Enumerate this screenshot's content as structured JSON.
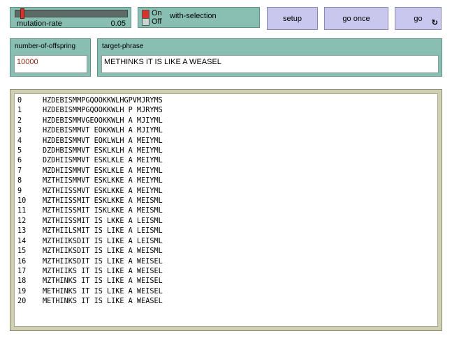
{
  "slider": {
    "label": "mutation-rate",
    "value": "0.05",
    "fraction": 0.05
  },
  "switch": {
    "label": "with-selection",
    "on_text": "On",
    "off_text": "Off",
    "state": "on"
  },
  "buttons": {
    "setup": "setup",
    "go_once": "go once",
    "go": "go",
    "forever_icon": "↻"
  },
  "number_of_offspring": {
    "label": "number-of-offspring",
    "value": "10000"
  },
  "target_phrase": {
    "label": "target-phrase",
    "value": "METHINKS IT IS LIKE A WEASEL"
  },
  "output": {
    "lines": [
      {
        "gen": "0",
        "text": "HZDEBISMMPGQOOKKWLHGPVMJRYMS"
      },
      {
        "gen": "1",
        "text": "HZDEBISMMPGQOOKKWLH P MJRYMS"
      },
      {
        "gen": "2",
        "text": "HZDEBISMMVGEOOKKWLH A MJIYML"
      },
      {
        "gen": "3",
        "text": "HZDEBISMMVT EOKKWLH A MJIYML"
      },
      {
        "gen": "4",
        "text": "HZDEBISMMVT EOKLWLH A MEIYML"
      },
      {
        "gen": "5",
        "text": "DZDHBISMMVT ESKLKLH A MEIYML"
      },
      {
        "gen": "6",
        "text": "DZDHIISMMVT ESKLKLE A MEIYML"
      },
      {
        "gen": "7",
        "text": "MZDHIISMMVT ESKLKLE A MEIYML"
      },
      {
        "gen": "8",
        "text": "MZTHIISMMVT ESKLKKE A MEIYML"
      },
      {
        "gen": "9",
        "text": "MZTHIISSMVT ESKLKKE A MEIYML"
      },
      {
        "gen": "10",
        "text": "MZTHIISSMIT ESKLKKE A MEISML"
      },
      {
        "gen": "11",
        "text": "MZTHIISSMIT ISKLKKE A MEISML"
      },
      {
        "gen": "12",
        "text": "MZTHIISSMIT IS LKKE A LEISML"
      },
      {
        "gen": "13",
        "text": "MZTHIILSMIT IS LIKE A LEISML"
      },
      {
        "gen": "14",
        "text": "MZTHIIKSDIT IS LIKE A LEISML"
      },
      {
        "gen": "15",
        "text": "MZTHIIKSDIT IS LIKE A WEISML"
      },
      {
        "gen": "16",
        "text": "MZTHIIKSDIT IS LIKE A WEISEL"
      },
      {
        "gen": "17",
        "text": "MZTHIIKS IT IS LIKE A WEISEL"
      },
      {
        "gen": "18",
        "text": "MZTHINKS IT IS LIKE A WEISEL"
      },
      {
        "gen": "19",
        "text": "METHINKS IT IS LIKE A WEISEL"
      },
      {
        "gen": "20",
        "text": "METHINKS IT IS LIKE A WEASEL"
      }
    ]
  }
}
